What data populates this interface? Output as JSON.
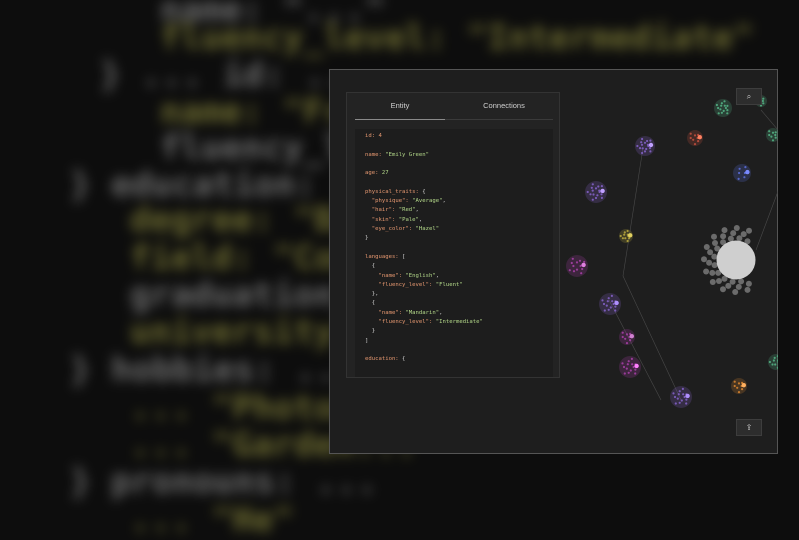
{
  "background_code": {
    "lines": [
      {
        "text": "name: \"...\"",
        "cls": "bg-white"
      },
      {
        "text": "fluency_level: \"Intermediate\"",
        "cls": "bg-yellow"
      },
      {
        "text": "} ... id: ...",
        "cls": "bg-white"
      },
      {
        "text": "name: \"Fren...\"",
        "cls": "bg-yellow"
      },
      {
        "text": "fluency_level: ...",
        "cls": "bg-white"
      },
      {
        "text": "} education: ...",
        "cls": "bg-white"
      },
      {
        "text": "degree: \"Bach...\"",
        "cls": "bg-yellow"
      },
      {
        "text": "field: \"Compute...\"",
        "cls": "bg-yellow"
      },
      {
        "text": "graduation_ye...",
        "cls": "bg-white"
      },
      {
        "text": "university: \"U...\"",
        "cls": "bg-yellow"
      },
      {
        "text": "} hobbies: ...",
        "cls": "bg-white"
      },
      {
        "text": "... \"Photog...\"",
        "cls": "bg-yellow"
      },
      {
        "text": "... \"Garden...\"",
        "cls": "bg-yellow"
      },
      {
        "text": "} pronouns: ...",
        "cls": "bg-white"
      },
      {
        "text": "... \"He\"",
        "cls": "bg-yellow"
      }
    ]
  },
  "panel": {
    "tabs": {
      "entity": "Entity",
      "connections": "Connections"
    },
    "code_lines": [
      {
        "parts": [
          [
            "k",
            "id: "
          ],
          [
            "k",
            "4"
          ]
        ]
      },
      {
        "parts": []
      },
      {
        "parts": [
          [
            "k",
            "name: "
          ],
          [
            "s",
            "\"Emily Green\""
          ]
        ]
      },
      {
        "parts": []
      },
      {
        "parts": [
          [
            "k",
            "age: "
          ],
          [
            "s",
            "27"
          ]
        ]
      },
      {
        "parts": []
      },
      {
        "parts": [
          [
            "k",
            "physical_traits: "
          ],
          [
            "p",
            "{"
          ]
        ]
      },
      {
        "parts": [
          [
            "p",
            "  "
          ],
          [
            "k",
            "\"physique\": "
          ],
          [
            "s",
            "\"Average\""
          ],
          [
            "p",
            ","
          ]
        ]
      },
      {
        "parts": [
          [
            "p",
            "  "
          ],
          [
            "k",
            "\"hair\": "
          ],
          [
            "s",
            "\"Red\""
          ],
          [
            "p",
            ","
          ]
        ]
      },
      {
        "parts": [
          [
            "p",
            "  "
          ],
          [
            "k",
            "\"skin\": "
          ],
          [
            "s",
            "\"Pale\""
          ],
          [
            "p",
            ","
          ]
        ]
      },
      {
        "parts": [
          [
            "p",
            "  "
          ],
          [
            "k",
            "\"eye_color\": "
          ],
          [
            "s",
            "\"Hazel\""
          ]
        ]
      },
      {
        "parts": [
          [
            "p",
            "}"
          ]
        ]
      },
      {
        "parts": []
      },
      {
        "parts": [
          [
            "k",
            "languages: "
          ],
          [
            "p",
            "["
          ]
        ]
      },
      {
        "parts": [
          [
            "p",
            "  {"
          ]
        ]
      },
      {
        "parts": [
          [
            "p",
            "    "
          ],
          [
            "k",
            "\"name\": "
          ],
          [
            "s",
            "\"English\""
          ],
          [
            "p",
            ","
          ]
        ]
      },
      {
        "parts": [
          [
            "p",
            "    "
          ],
          [
            "k",
            "\"fluency_level\": "
          ],
          [
            "s",
            "\"Fluent\""
          ]
        ]
      },
      {
        "parts": [
          [
            "p",
            "  },"
          ]
        ]
      },
      {
        "parts": [
          [
            "p",
            "  {"
          ]
        ]
      },
      {
        "parts": [
          [
            "p",
            "    "
          ],
          [
            "k",
            "\"name\": "
          ],
          [
            "s",
            "\"Mandarin\""
          ],
          [
            "p",
            ","
          ]
        ]
      },
      {
        "parts": [
          [
            "p",
            "    "
          ],
          [
            "k",
            "\"fluency_level\": "
          ],
          [
            "s",
            "\"Intermediate\""
          ]
        ]
      },
      {
        "parts": [
          [
            "p",
            "  }"
          ]
        ]
      },
      {
        "parts": [
          [
            "p",
            "]"
          ]
        ]
      },
      {
        "parts": []
      },
      {
        "parts": [
          [
            "k",
            "education: "
          ],
          [
            "p",
            "{"
          ]
        ]
      }
    ]
  },
  "buttons": {
    "search_icon": "⌕",
    "export_icon": "⇪"
  },
  "colors": {
    "green": "#4ea37a",
    "purple": "#7a5bb8",
    "red": "#b24a3a",
    "blue": "#5566c8",
    "magenta": "#9a3c9a",
    "olive": "#a89a3a",
    "orange": "#c57a2e",
    "gray": "#6b6b6b",
    "center": "#cfcfcf"
  }
}
